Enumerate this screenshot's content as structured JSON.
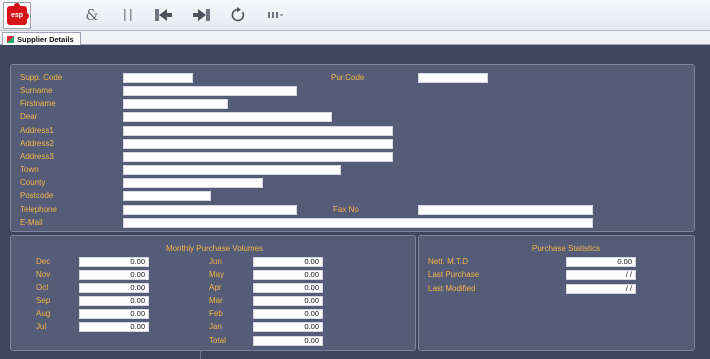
{
  "app": {
    "logo_text": "esp"
  },
  "toolbar": {
    "buttons": [
      {
        "name": "ampersand-icon"
      },
      {
        "name": "pause-icon"
      },
      {
        "name": "back-icon"
      },
      {
        "name": "forward-icon"
      },
      {
        "name": "refresh-icon"
      },
      {
        "name": "record-nav-icon"
      }
    ]
  },
  "tabs": [
    {
      "label": "Supplier Details"
    }
  ],
  "supplier": {
    "supp_code_label": "Supp. Code",
    "pur_code_label": "Pur.Code",
    "surname_label": "Surname",
    "firstname_label": "Firstname",
    "dear_label": "Dear",
    "address1_label": "Address1",
    "address2_label": "Address2",
    "address3_label": "Address3",
    "town_label": "Town",
    "county_label": "County",
    "postcode_label": "Postcode",
    "telephone_label": "Telephone",
    "fax_label": "Fax No",
    "email_label": "E-Mail",
    "values": {
      "supp_code": "",
      "pur_code": "",
      "surname": "",
      "firstname": "",
      "dear": "",
      "address1": "",
      "address2": "",
      "address3": "",
      "town": "",
      "county": "",
      "postcode": "",
      "telephone": "",
      "fax": "",
      "email": ""
    }
  },
  "monthly": {
    "title": "Monthly Purchase Volumes",
    "left": [
      {
        "month": "Dec",
        "value": "0.00"
      },
      {
        "month": "Nov",
        "value": "0.00"
      },
      {
        "month": "Oct",
        "value": "0.00"
      },
      {
        "month": "Sep",
        "value": "0.00"
      },
      {
        "month": "Aug",
        "value": "0.00"
      },
      {
        "month": "Jul",
        "value": "0.00"
      }
    ],
    "right": [
      {
        "month": "Jun",
        "value": "0.00"
      },
      {
        "month": "May",
        "value": "0.00"
      },
      {
        "month": "Apr",
        "value": "0.00"
      },
      {
        "month": "Mar",
        "value": "0.00"
      },
      {
        "month": "Feb",
        "value": "0.00"
      },
      {
        "month": "Jan",
        "value": "0.00"
      },
      {
        "month": "Total",
        "value": "0.00"
      }
    ]
  },
  "stats": {
    "title": "Purchase Statistics",
    "nett_mtd_label": "Nett. M.T.D",
    "nett_mtd": "0.00",
    "last_purchase_label": "Last Purchase",
    "last_purchase": "/ /",
    "last_modified_label": "Last Modified",
    "last_modified": "/ /"
  }
}
